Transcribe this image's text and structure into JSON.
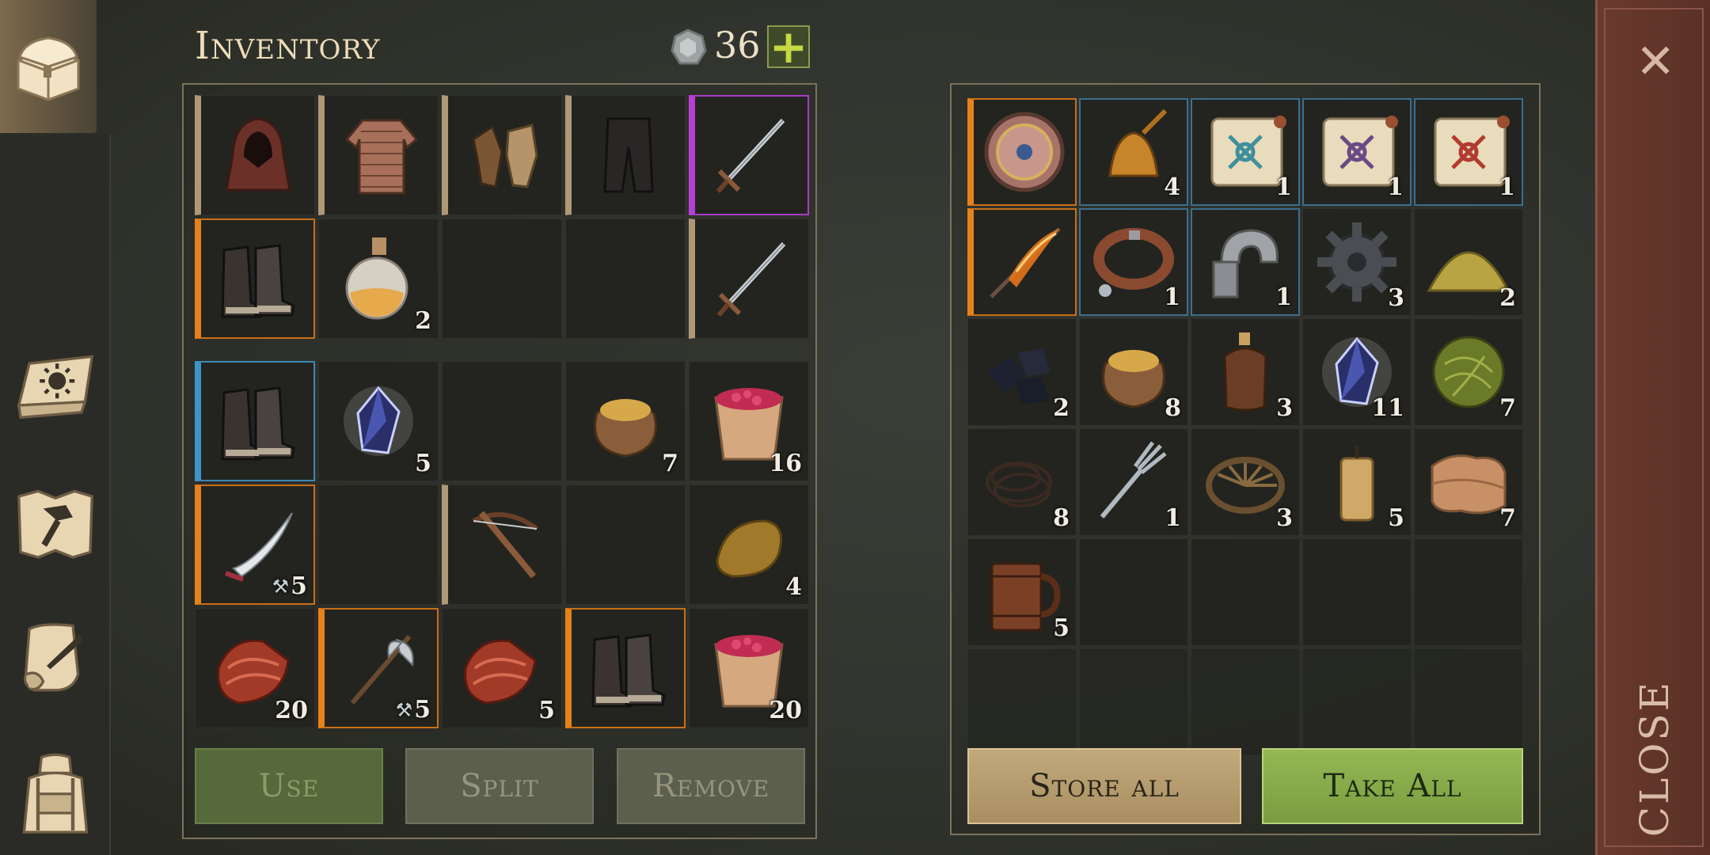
{
  "header": {
    "title": "Inventory",
    "coins": "36",
    "plus_label": "+"
  },
  "sidebar": {
    "items": [
      {
        "name": "chest",
        "icon": "chest-icon"
      },
      {
        "name": "journal",
        "icon": "sun-book-icon"
      },
      {
        "name": "crafting",
        "icon": "hammer-map-icon"
      },
      {
        "name": "scrolls",
        "icon": "scroll-quill-icon"
      },
      {
        "name": "backpack",
        "icon": "backpack-icon"
      }
    ]
  },
  "equipment": [
    {
      "item": "hood",
      "icon": "hood-icon",
      "quality": "tan",
      "qty": ""
    },
    {
      "item": "chainmail-shirt",
      "icon": "shirt-icon",
      "quality": "tan",
      "qty": ""
    },
    {
      "item": "gloves",
      "icon": "gloves-icon",
      "quality": "tan",
      "qty": ""
    },
    {
      "item": "pants",
      "icon": "pants-icon",
      "quality": "tan",
      "qty": ""
    },
    {
      "item": "longsword",
      "icon": "sword-icon",
      "quality": "purple",
      "qty": ""
    },
    {
      "item": "boots",
      "icon": "boots-icon",
      "quality": "orange",
      "qty": ""
    },
    {
      "item": "potion",
      "icon": "potion-icon",
      "quality": "none",
      "qty": "2"
    },
    {
      "item": "empty",
      "icon": "",
      "quality": "none",
      "qty": ""
    },
    {
      "item": "empty",
      "icon": "",
      "quality": "none",
      "qty": ""
    },
    {
      "item": "sword",
      "icon": "sword-icon",
      "quality": "tan",
      "qty": ""
    }
  ],
  "backpack": [
    {
      "item": "leather-boots",
      "icon": "boots-icon",
      "quality": "blue",
      "qty": ""
    },
    {
      "item": "crystal",
      "icon": "crystal-icon",
      "quality": "none",
      "qty": "5"
    },
    {
      "item": "empty",
      "icon": "",
      "quality": "none",
      "qty": ""
    },
    {
      "item": "grain-sack",
      "icon": "sack-icon",
      "quality": "none",
      "qty": "7"
    },
    {
      "item": "berry-bucket",
      "icon": "bucket-icon",
      "quality": "none",
      "qty": "16"
    },
    {
      "item": "scimitar",
      "icon": "scimitar-icon",
      "quality": "orange",
      "qty": "5",
      "dmg": true
    },
    {
      "item": "empty",
      "icon": "",
      "quality": "none",
      "qty": ""
    },
    {
      "item": "crossbow",
      "icon": "crossbow-icon",
      "quality": "tan",
      "qty": ""
    },
    {
      "item": "empty",
      "icon": "",
      "quality": "none",
      "qty": ""
    },
    {
      "item": "bread-loaf",
      "icon": "loaf-icon",
      "quality": "none",
      "qty": "4"
    },
    {
      "item": "raw-meat",
      "icon": "meat-icon",
      "quality": "none",
      "qty": "20"
    },
    {
      "item": "halberd",
      "icon": "halberd-icon",
      "quality": "orange",
      "qty": "5",
      "dmg": true
    },
    {
      "item": "raw-meat",
      "icon": "meat-icon",
      "quality": "none",
      "qty": "5"
    },
    {
      "item": "boots",
      "icon": "boots-icon",
      "quality": "orange",
      "qty": ""
    },
    {
      "item": "berry-bucket",
      "icon": "bucket-icon",
      "quality": "none",
      "qty": "20"
    }
  ],
  "storage": [
    {
      "item": "round-shield",
      "icon": "shield-icon",
      "quality": "orange",
      "qty": ""
    },
    {
      "item": "bell",
      "icon": "bell-icon",
      "quality": "teal",
      "qty": "4"
    },
    {
      "item": "scroll-blue",
      "icon": "scroll-icon",
      "quality": "teal",
      "qty": "1",
      "ink": "#3f8f9c"
    },
    {
      "item": "scroll-purple",
      "icon": "scroll-icon",
      "quality": "teal",
      "qty": "1",
      "ink": "#6a4a86"
    },
    {
      "item": "scroll-red",
      "icon": "scroll-icon",
      "quality": "teal",
      "qty": "1",
      "ink": "#b23a30"
    },
    {
      "item": "flame-sword",
      "icon": "flame-sword-icon",
      "quality": "orange",
      "qty": ""
    },
    {
      "item": "collar",
      "icon": "collar-icon",
      "quality": "teal",
      "qty": "1"
    },
    {
      "item": "shackle",
      "icon": "shackle-icon",
      "quality": "teal",
      "qty": "1"
    },
    {
      "item": "gear",
      "icon": "gear-icon",
      "quality": "none",
      "qty": "3"
    },
    {
      "item": "powder-pile",
      "icon": "pile-icon",
      "quality": "none",
      "qty": "2"
    },
    {
      "item": "coal",
      "icon": "coal-icon",
      "quality": "none",
      "qty": "2"
    },
    {
      "item": "grain-sack",
      "icon": "sack-icon",
      "quality": "none",
      "qty": "8"
    },
    {
      "item": "leather-flask",
      "icon": "flask-icon",
      "quality": "none",
      "qty": "3"
    },
    {
      "item": "crystal",
      "icon": "crystal-icon",
      "quality": "none",
      "qty": "11"
    },
    {
      "item": "herb-ball",
      "icon": "herb-icon",
      "quality": "none",
      "qty": "7"
    },
    {
      "item": "wire",
      "icon": "wire-icon",
      "quality": "none",
      "qty": "8"
    },
    {
      "item": "fork",
      "icon": "fork-icon",
      "quality": "none",
      "qty": "1"
    },
    {
      "item": "bear-trap",
      "icon": "trap-icon",
      "quality": "none",
      "qty": "3"
    },
    {
      "item": "candle",
      "icon": "candle-icon",
      "quality": "none",
      "qty": "5"
    },
    {
      "item": "cloth",
      "icon": "cloth-icon",
      "quality": "none",
      "qty": "7"
    },
    {
      "item": "tankard",
      "icon": "tankard-icon",
      "quality": "none",
      "qty": "5"
    },
    {
      "item": "empty",
      "icon": "",
      "quality": "none",
      "qty": ""
    },
    {
      "item": "empty",
      "icon": "",
      "quality": "none",
      "qty": ""
    },
    {
      "item": "empty",
      "icon": "",
      "quality": "none",
      "qty": ""
    },
    {
      "item": "empty",
      "icon": "",
      "quality": "none",
      "qty": ""
    }
  ],
  "actions": {
    "use": "Use",
    "split": "Split",
    "remove": "Remove",
    "store_all": "Store all",
    "take_all": "Take All"
  },
  "close": {
    "x": "✕",
    "label": "CLOSE"
  },
  "colors": {
    "quality_tan": "#b09776",
    "quality_orange": "#e5821b",
    "quality_purple": "#b640d4",
    "quality_blue": "#3d94c8",
    "quality_teal": "#3b6f8c",
    "take_all": "#88ac4a",
    "store_all": "#b89e70"
  }
}
